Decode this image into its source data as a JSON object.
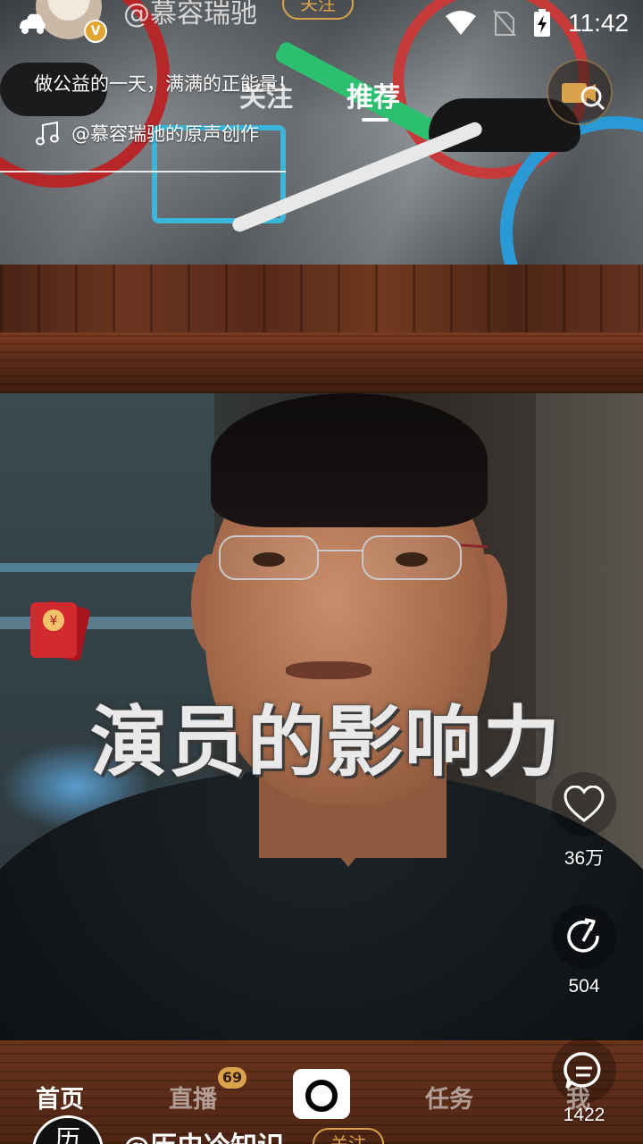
{
  "status_bar": {
    "time": "11:42"
  },
  "previous_video": {
    "author": "@慕容瑞驰",
    "follow_label": "关注",
    "description": "做公益的一天，满满的正能量！",
    "music": "@慕容瑞驰的原声创作",
    "verified_badge": "V"
  },
  "top_tabs": {
    "follow": "关注",
    "recommend": "推荐",
    "active": "推荐"
  },
  "current_video": {
    "caption": "演员的影响力",
    "like_count": "36万",
    "share_count": "504",
    "comment_count": "1422"
  },
  "bottom_nav": {
    "home": "首页",
    "live": "直播",
    "live_badge": "69",
    "task": "任务",
    "me": "我",
    "active": "首页"
  },
  "next_video": {
    "avatar_text": "历",
    "author": "@历史冷知识",
    "follow_label": "关注"
  },
  "colors": {
    "accent_gold": "#d9a24b",
    "wood_dark": "#4e2514",
    "wood_light": "#6b3520"
  },
  "icons": {
    "status_left": "app-notification-icon",
    "wifi": "wifi-icon",
    "no_sim": "no-sim-icon",
    "battery": "battery-charging-icon",
    "music": "music-note-icon",
    "video_search": "video-search-icon",
    "like": "heart-icon",
    "share": "share-arrow-icon",
    "comment": "comment-bubble-icon",
    "camera": "camera-icon",
    "red_packet": "red-packet-icon"
  }
}
